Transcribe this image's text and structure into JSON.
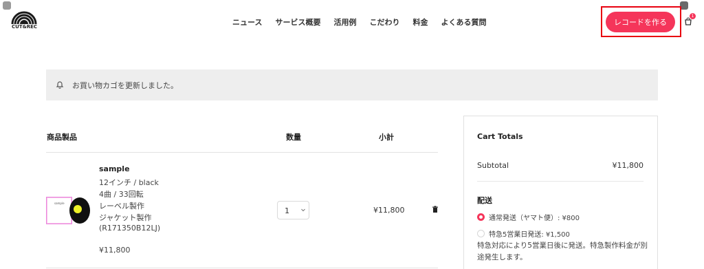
{
  "brand": {
    "logo_text": "CUT&REC"
  },
  "nav": {
    "items": [
      "ニュース",
      "サービス概要",
      "活用例",
      "こだわり",
      "料金",
      "よくある質問"
    ]
  },
  "header": {
    "cta_label": "レコードを作る",
    "cart_count": "1"
  },
  "notice": {
    "message": "お買い物カゴを更新しました。"
  },
  "table": {
    "headers": {
      "product": "商品製品",
      "quantity": "数量",
      "subtotal": "小計"
    },
    "item": {
      "title": "sample",
      "sleeve_text": "sample",
      "details": [
        "12インチ / black",
        "4曲 / 33回転",
        "レーベル製作",
        "ジャケット製作",
        "(R171350B12LJ)"
      ],
      "price": "¥11,800",
      "quantity": "1",
      "subtotal": "¥11,800"
    }
  },
  "totals": {
    "title": "Cart Totals",
    "subtotal_label": "Subtotal",
    "subtotal_value": "¥11,800",
    "shipping_label": "配送",
    "shipping_options": [
      {
        "label": "通常発送（ヤマト便）: ¥800",
        "selected": true
      },
      {
        "label": "特急5営業日発送: ¥1,500",
        "selected": false
      }
    ],
    "shipping_note": "特急対応により5営業日後に発送。特急製作料金が別途発生します。"
  },
  "colors": {
    "accent": "#f5355a",
    "highlight_frame": "#e8000f",
    "notice_background": "#eeeeee",
    "record_label": "#eef028"
  }
}
